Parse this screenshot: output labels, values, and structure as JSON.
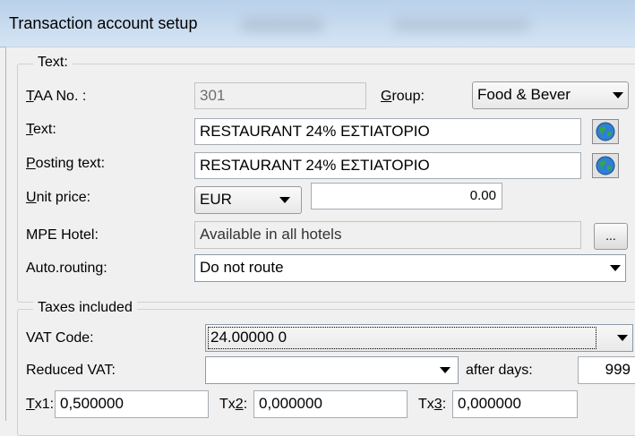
{
  "window": {
    "title": "Transaction account setup"
  },
  "text_group": {
    "legend": "Text:",
    "taa_no": {
      "label_u": "T",
      "label_rest": "AA No. :",
      "value": "301"
    },
    "group": {
      "label_u": "G",
      "label_rest": "roup:",
      "value": "Food & Bever"
    },
    "text": {
      "label_u": "T",
      "label_rest": "ext:",
      "value": "RESTAURANT 24% ΕΣΤΙΑΤΟΡΙΟ"
    },
    "posting_text": {
      "label_u": "P",
      "label_rest": "osting text:",
      "value": "RESTAURANT 24% ΕΣΤΙΑΤΟΡΙΟ"
    },
    "unit_price": {
      "label_u": "U",
      "label_rest": "nit price:",
      "currency": "EUR",
      "amount": "0.00"
    },
    "mpe_hotel": {
      "label": "MPE Hotel:",
      "value": "Available in all hotels",
      "button": "..."
    },
    "auto_routing": {
      "label": "Auto.routing:",
      "value": "Do not route"
    }
  },
  "taxes_group": {
    "legend": "Taxes included",
    "vat_code": {
      "label": "VAT Code:",
      "value": "24.00000  0"
    },
    "reduced_vat": {
      "label": "Reduced VAT:",
      "value": "",
      "after_days_label": "after days:",
      "after_days_value": "999"
    },
    "tx1": {
      "label_u": "T",
      "label_rest": "x1:",
      "value": "0,500000"
    },
    "tx2": {
      "label_pre": "Tx",
      "label_u": "2",
      "label_rest": ":",
      "value": "0,000000"
    },
    "tx3": {
      "label_pre": "Tx",
      "label_u": "3",
      "label_rest": ":",
      "value": "0,000000"
    }
  },
  "icons": {
    "translate": "globe-icon"
  },
  "colors": {
    "titlebar": "#c5d9ee",
    "window_bg": "#f0f0f0"
  }
}
